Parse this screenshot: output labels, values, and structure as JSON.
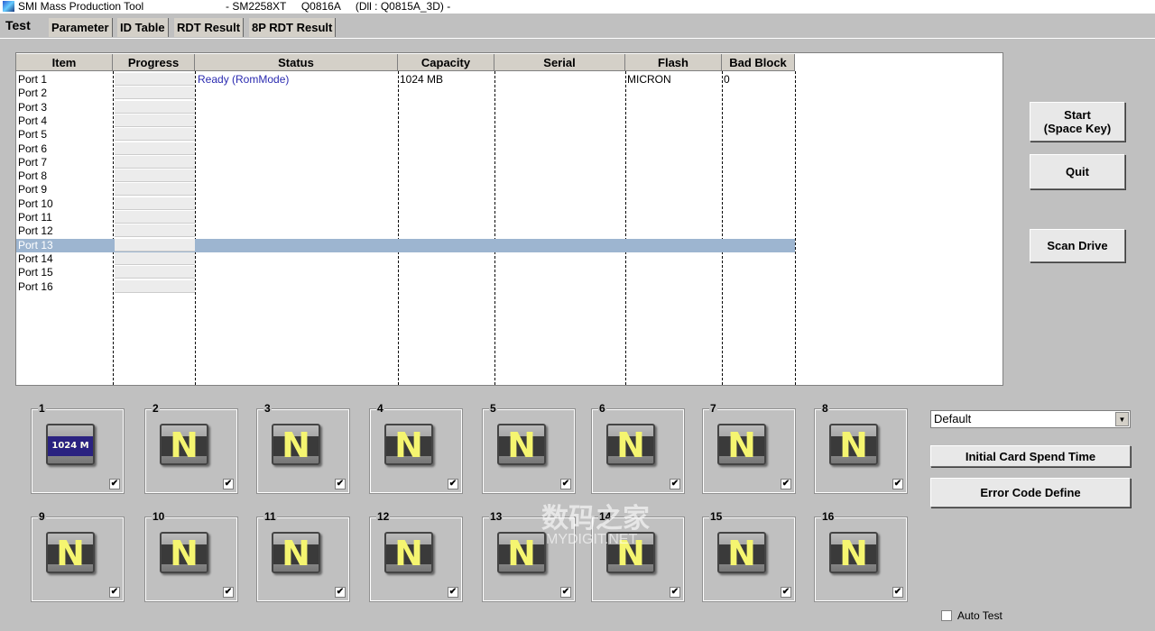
{
  "window": {
    "title": "SMI Mass Production Tool",
    "subtitle": "- SM2258XT     Q0816A     (Dll : Q0815A_3D) -"
  },
  "tabs": [
    "Test",
    "Parameter",
    "ID Table",
    "RDT Result",
    "8P RDT Result"
  ],
  "table": {
    "columns": [
      "Item",
      "Progress",
      "Status",
      "Capacity",
      "Serial",
      "Flash",
      "Bad Block"
    ],
    "rows": [
      {
        "item": "Port 1",
        "progress": 0,
        "status": "Ready (RomMode)",
        "capacity": "1024 MB",
        "serial": "",
        "flash": "MICRON",
        "bad_block": "0"
      },
      {
        "item": "Port 2"
      },
      {
        "item": "Port 3"
      },
      {
        "item": "Port 4"
      },
      {
        "item": "Port 5"
      },
      {
        "item": "Port 6"
      },
      {
        "item": "Port 7"
      },
      {
        "item": "Port 8"
      },
      {
        "item": "Port 9"
      },
      {
        "item": "Port 10"
      },
      {
        "item": "Port 11"
      },
      {
        "item": "Port 12"
      },
      {
        "item": "Port 13",
        "selected": true
      },
      {
        "item": "Port 14"
      },
      {
        "item": "Port 15"
      },
      {
        "item": "Port 16"
      }
    ]
  },
  "buttons": {
    "start": "Start\n(Space Key)",
    "quit": "Quit",
    "scan": "Scan Drive",
    "initial": "Initial Card Spend Time",
    "error": "Error Code Define"
  },
  "dropdown": {
    "value": "Default"
  },
  "ports": [
    {
      "n": "1",
      "label": "1024 M",
      "checked": true
    },
    {
      "n": "2",
      "label": "N",
      "checked": true
    },
    {
      "n": "3",
      "label": "N",
      "checked": true
    },
    {
      "n": "4",
      "label": "N",
      "checked": true
    },
    {
      "n": "5",
      "label": "N",
      "checked": true
    },
    {
      "n": "6",
      "label": "N",
      "checked": true
    },
    {
      "n": "7",
      "label": "N",
      "checked": true
    },
    {
      "n": "8",
      "label": "N",
      "checked": true
    },
    {
      "n": "9",
      "label": "N",
      "checked": true
    },
    {
      "n": "10",
      "label": "N",
      "checked": true
    },
    {
      "n": "11",
      "label": "N",
      "checked": true
    },
    {
      "n": "12",
      "label": "N",
      "checked": true
    },
    {
      "n": "13",
      "label": "N",
      "checked": true
    },
    {
      "n": "14",
      "label": "N",
      "checked": true
    },
    {
      "n": "15",
      "label": "N",
      "checked": true
    },
    {
      "n": "16",
      "label": "N",
      "checked": true
    }
  ],
  "auto_test": {
    "label": "Auto Test",
    "checked": false
  },
  "watermark": {
    "cn": "数码之家",
    "en": "MYDIGIT.NET"
  },
  "colors": {
    "status_text": "#2a2ab0",
    "selected_row": "#9db5d0"
  }
}
